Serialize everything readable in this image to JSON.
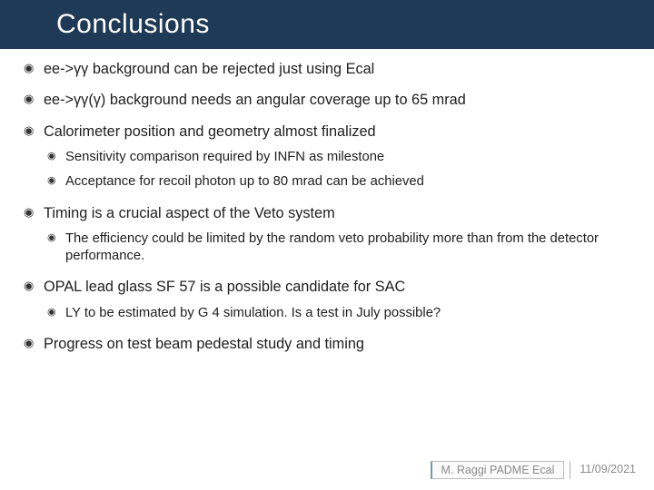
{
  "title": "Conclusions",
  "b": {
    "i0": "ee->γγ background can be rejected just using Ecal",
    "i1": "ee->γγ(γ) background needs an angular coverage up to 65 mrad",
    "i2": "Calorimeter position and geometry almost finalized",
    "i2s0": "Sensitivity comparison required by INFN as milestone",
    "i2s1": "Acceptance for recoil photon up to 80 mrad can be achieved",
    "i3": "Timing is a crucial aspect of the Veto system",
    "i3s0": "The efficiency could be limited by the random veto probability more than from the detector performance.",
    "i4": "OPAL lead glass SF 57 is a possible candidate for SAC",
    "i4s0": "LY to be estimated by G 4 simulation. Is a test in July possible?",
    "i5": "Progress on test beam pedestal study and timing"
  },
  "footer": {
    "author": "M. Raggi PADME Ecal",
    "date": "11/09/2021"
  }
}
